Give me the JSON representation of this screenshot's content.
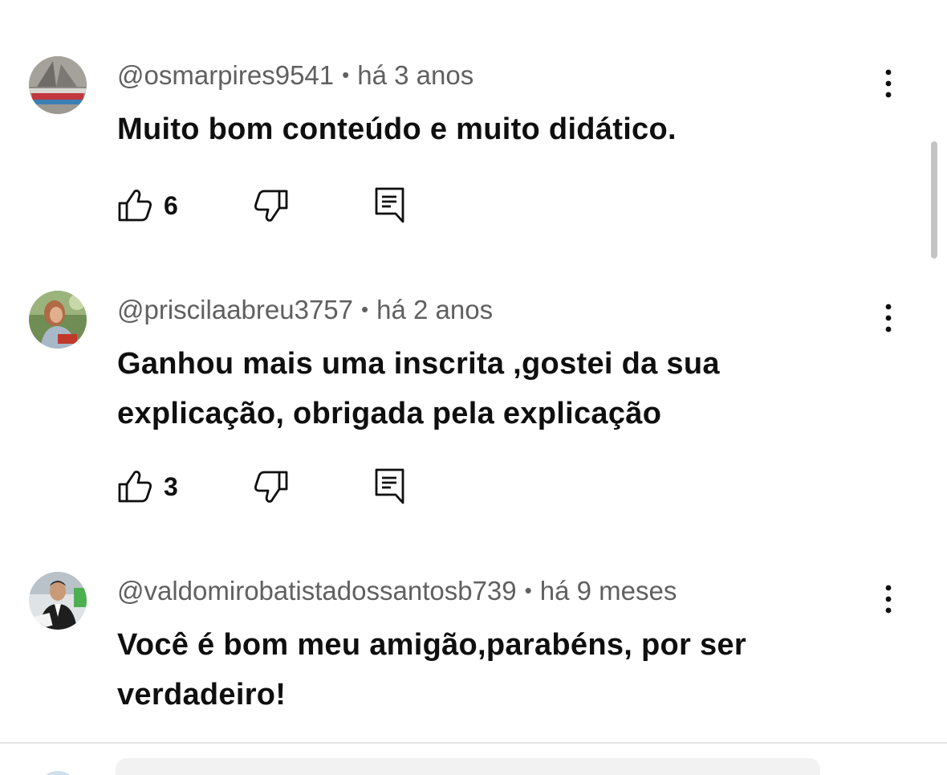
{
  "comments": [
    {
      "author": "@osmarpires9541",
      "separator": "•",
      "time": "há 3 anos",
      "text": "Muito bom conteúdo e muito didático.",
      "likes": "6"
    },
    {
      "author": "@priscilaabreu3757",
      "separator": "•",
      "time": "há 2 anos",
      "text": "Ganhou mais uma inscrita ,gostei da sua explicação, obrigada pela explicação",
      "likes": "3"
    },
    {
      "author": "@valdomirobatistadossantosb739",
      "separator": "•",
      "time": "há 9 meses",
      "text": "Você é bom meu amigão,parabéns, por ser verdadeiro!"
    }
  ],
  "colors": {
    "text": "#0f0f0f",
    "meta": "#606060",
    "icon": "#0f0f0f"
  },
  "icons": {
    "like": "thumbs-up-icon",
    "dislike": "thumbs-down-icon",
    "reply": "reply-icon",
    "more": "more-vertical-icon"
  }
}
